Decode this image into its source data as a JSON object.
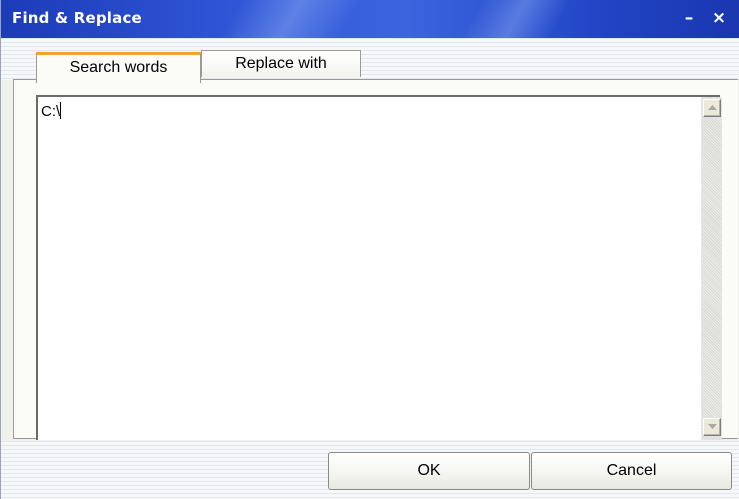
{
  "window": {
    "title": "Find & Replace",
    "minimize_glyph": "–",
    "close_glyph": "×"
  },
  "tabs": [
    {
      "label": "Search words",
      "active": true
    },
    {
      "label": "Replace with",
      "active": false
    }
  ],
  "search_text": "C:\\",
  "buttons": {
    "ok": "OK",
    "cancel": "Cancel"
  },
  "icons": {
    "scroll_up": "scroll-up-arrow-icon",
    "scroll_down": "scroll-down-arrow-icon"
  },
  "colors": {
    "titlebar": "#2f55d6",
    "active_tab_accent": "#f0a431"
  }
}
